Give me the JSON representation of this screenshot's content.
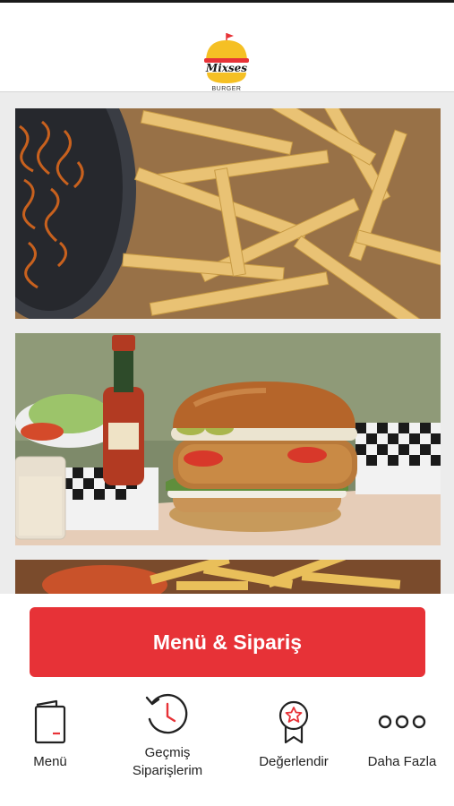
{
  "header": {
    "logo_text": "Mixses",
    "logo_subtext": "BURGER"
  },
  "feed": {
    "cards": [
      {
        "name": "fries-photo"
      },
      {
        "name": "burger-photo"
      },
      {
        "name": "fries-photo-partial"
      }
    ]
  },
  "cta": {
    "label": "Menü & Sipariş"
  },
  "nav": {
    "menu": "Menü",
    "history_line1": "Geçmiş",
    "history_line2": "Siparişlerim",
    "rate": "Değerlendir",
    "more": "Daha Fazla"
  },
  "colors": {
    "accent": "#e73237",
    "logo_yellow": "#f5c024"
  }
}
